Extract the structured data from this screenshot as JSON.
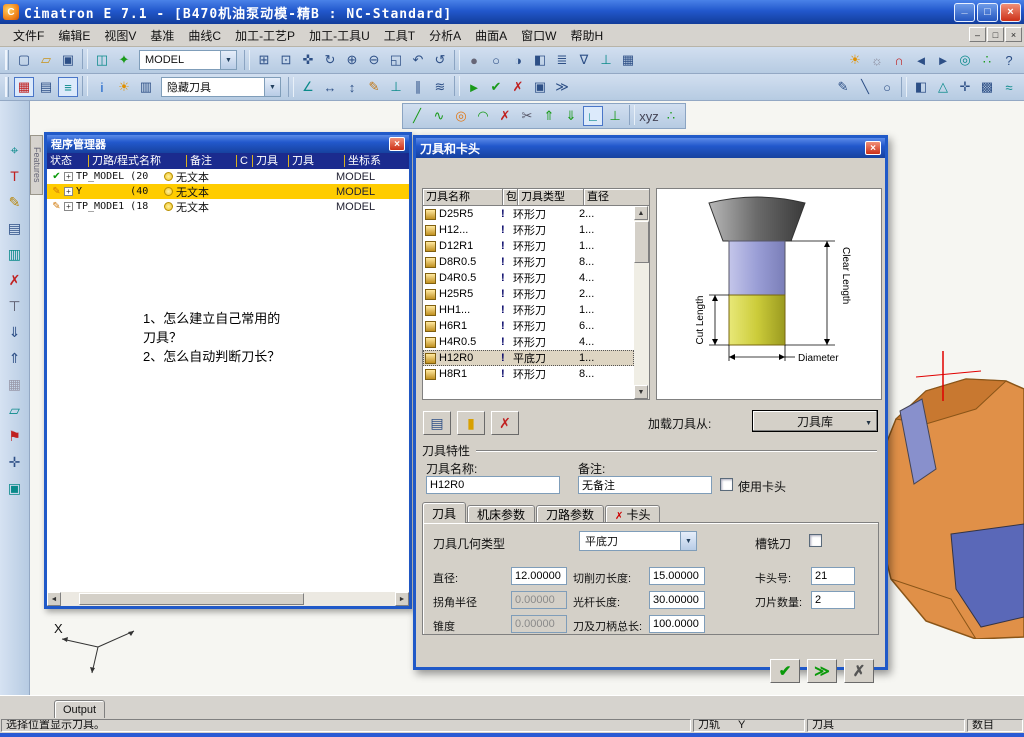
{
  "window": {
    "title": "Cimatron E 7.1 - [B470机油泵动模-精B : NC-Standard]"
  },
  "menu": {
    "items": [
      {
        "label": "文件F"
      },
      {
        "label": "编辑E"
      },
      {
        "label": "视图V"
      },
      {
        "label": "基准"
      },
      {
        "label": "曲线C"
      },
      {
        "label": "加工-工艺P"
      },
      {
        "label": "加工-工具U"
      },
      {
        "label": "工具T"
      },
      {
        "label": "分析A"
      },
      {
        "label": "曲面A"
      },
      {
        "label": "窗口W"
      },
      {
        "label": "帮助H"
      }
    ]
  },
  "combos": {
    "model": "MODEL",
    "hide": "隐藏刀具"
  },
  "features_tab": "Features",
  "toolbars": {
    "tb1a": [
      {
        "n": "new-file-icon",
        "g": "▢",
        "c": "#2d4f86"
      },
      {
        "n": "open-file-icon",
        "g": "▱",
        "c": "#c8931a"
      },
      {
        "n": "save-icon",
        "g": "▣",
        "c": "#2d4f86"
      },
      "|",
      {
        "n": "load-model-icon",
        "g": "◫",
        "c": "#0a8a8a"
      },
      {
        "n": "refresh-model-icon",
        "g": "✦",
        "c": "#1a9a1a"
      }
    ],
    "tb1b": [
      {
        "n": "select-filter-icon",
        "g": "⊞",
        "c": "#2d4f86"
      },
      {
        "n": "zoom-window-icon",
        "g": "⊡",
        "c": "#2d4f86"
      },
      {
        "n": "pan-icon",
        "g": "✜",
        "c": "#2d4f86"
      },
      {
        "n": "rotate-view-icon",
        "g": "↻",
        "c": "#2d4f86"
      },
      {
        "n": "zoom-in-icon",
        "g": "⊕",
        "c": "#2d4f86"
      },
      {
        "n": "zoom-out-icon",
        "g": "⊖",
        "c": "#2d4f86"
      },
      {
        "n": "zoom-fit-icon",
        "g": "◱",
        "c": "#2d4f86"
      },
      {
        "n": "previous-view-icon",
        "g": "↶",
        "c": "#2d4f86"
      },
      {
        "n": "redraw-icon",
        "g": "↺",
        "c": "#2d4f86"
      }
    ],
    "tb1c": [
      {
        "n": "shaded-display-icon",
        "g": "●",
        "c": "#667"
      },
      {
        "n": "wireframe-display-icon",
        "g": "○",
        "c": "#2d4f86"
      },
      {
        "n": "hidden-line-icon",
        "g": "◑",
        "c": "#2d4f86"
      },
      {
        "n": "section-icon",
        "g": "◧",
        "c": "#2d4f86"
      },
      {
        "n": "layers-icon",
        "g": "≣",
        "c": "#2d4f86"
      },
      {
        "n": "display-filter-icon",
        "g": "∇",
        "c": "#2d4f86"
      },
      {
        "n": "ucs-icon",
        "g": "⊥",
        "c": "#0a8a8a"
      },
      {
        "n": "grid-icon",
        "g": "▦",
        "c": "#2d4f86"
      }
    ],
    "tb1r": [
      {
        "n": "light-on-icon",
        "g": "☀",
        "c": "#e09000"
      },
      {
        "n": "light-off-icon",
        "g": "☼",
        "c": "#889"
      },
      {
        "n": "magnet-icon",
        "g": "∩",
        "c": "#c02020"
      },
      {
        "n": "step-back-icon",
        "g": "◄",
        "c": "#2d4f86"
      },
      {
        "n": "step-forward-icon",
        "g": "►",
        "c": "#2d4f86"
      },
      {
        "n": "target-icon",
        "g": "◎",
        "c": "#0a8a8a"
      },
      {
        "n": "snap-points-icon",
        "g": "∴",
        "c": "#1a9a1a"
      },
      {
        "n": "help-icon",
        "g": "?",
        "c": "#2d4f86"
      }
    ],
    "tb2a": [
      {
        "n": "program-manager-icon",
        "g": "▦",
        "c": "#c02020",
        "a": 1
      },
      {
        "n": "process-table-icon",
        "g": "▤",
        "c": "#2d4f86"
      },
      {
        "n": "tool-manager-icon",
        "g": "≡",
        "c": "#0a8a8a",
        "a": 1
      },
      "|",
      {
        "n": "info-icon",
        "g": "i",
        "c": "#0a58c8"
      },
      {
        "n": "show-hide-icon",
        "g": "☀",
        "c": "#e09000"
      },
      {
        "n": "report-icon",
        "g": "▥",
        "c": "#2d4f86"
      }
    ],
    "tb2b": [
      {
        "n": "measure-angle-icon",
        "g": "∠",
        "c": "#0a8a8a"
      },
      {
        "n": "measure-distance-icon",
        "g": "↔",
        "c": "#2d4f86"
      },
      {
        "n": "measure-height-icon",
        "g": "↕",
        "c": "#2d4f86"
      },
      {
        "n": "annotate-icon",
        "g": "✎",
        "c": "#c07818"
      },
      {
        "n": "normal-check-icon",
        "g": "⊥",
        "c": "#0a8a8a"
      },
      {
        "n": "parallel-icon",
        "g": "∥",
        "c": "#2d4f86"
      },
      {
        "n": "surface-analysis-icon",
        "g": "≋",
        "c": "#2d4f86"
      },
      "|",
      {
        "n": "simulate-icon",
        "g": "►",
        "c": "#1a9a1a"
      },
      {
        "n": "verify-icon",
        "g": "✔",
        "c": "#1a9a1a"
      },
      {
        "n": "stop-icon",
        "g": "✗",
        "c": "#c02020"
      },
      {
        "n": "nc-output-icon",
        "g": "▣",
        "c": "#2d4f86"
      },
      {
        "n": "post-process-icon",
        "g": "≫",
        "c": "#2d4f86"
      }
    ],
    "tb2r": [
      {
        "n": "sketch-icon",
        "g": "✎",
        "c": "#2d4f86"
      },
      {
        "n": "line-tool-icon",
        "g": "╲",
        "c": "#2d4f86"
      },
      {
        "n": "circle-tool-icon",
        "g": "○",
        "c": "#2d4f86"
      },
      "|",
      {
        "n": "solid-icon",
        "g": "◧",
        "c": "#2d4f86"
      },
      {
        "n": "mesh-icon",
        "g": "△",
        "c": "#0a8a8a"
      },
      {
        "n": "axes-icon",
        "g": "✛",
        "c": "#2d4f86"
      },
      {
        "n": "hatch-icon",
        "g": "▩",
        "c": "#2d4f86"
      },
      {
        "n": "smooth-icon",
        "g": "≈",
        "c": "#0a8a8a"
      }
    ],
    "tb3": [
      {
        "n": "line-icon",
        "g": "╱",
        "c": "#1a9a1a"
      },
      {
        "n": "spline-icon",
        "g": "∿",
        "c": "#1a9a1a"
      },
      {
        "n": "circle-icon",
        "g": "◎",
        "c": "#e07818"
      },
      {
        "n": "arc-icon",
        "g": "◠",
        "c": "#1a9a1a"
      },
      {
        "n": "delete-icon",
        "g": "✗",
        "c": "#c02020"
      },
      {
        "n": "trim-icon",
        "g": "✂",
        "c": "#556"
      },
      {
        "n": "extend-up-icon",
        "g": "⇑",
        "c": "#1a9a1a"
      },
      {
        "n": "extend-down-icon",
        "g": "⇓",
        "c": "#1a9a1a"
      },
      {
        "n": "corner-icon",
        "g": "∟",
        "c": "#0a8a8a",
        "a": 1
      },
      {
        "n": "perpendicular-icon",
        "g": "⊥",
        "c": "#1a9a1a"
      },
      "|",
      {
        "n": "xyz-coords-icon",
        "g": "xyz",
        "c": "#445"
      },
      {
        "n": "snap-point-icon",
        "g": "∴",
        "c": "#1a9a1a"
      }
    ],
    "left": [
      {
        "n": "select-target-icon",
        "g": "⌖",
        "c": "#0a8a8a"
      },
      {
        "n": "text-tool-icon",
        "g": "T",
        "c": "#c02020"
      },
      {
        "n": "edit-sketch-icon",
        "g": "✎",
        "c": "#b8860b"
      },
      {
        "n": "document-icon",
        "g": "▤",
        "c": "#2d4f86"
      },
      {
        "n": "catalog-icon",
        "g": "▥",
        "c": "#0a8a8a"
      },
      {
        "n": "delete-entity-icon",
        "g": "✗",
        "c": "#c02020"
      },
      {
        "n": "tool-icon",
        "g": "⊤",
        "c": "#556"
      },
      {
        "n": "import-icon",
        "g": "⇓",
        "c": "#2d4f86"
      },
      {
        "n": "export-icon",
        "g": "⇑",
        "c": "#2d4f86"
      },
      {
        "n": "grid-icon",
        "g": "▦",
        "c": "#99a"
      },
      {
        "n": "plane-icon",
        "g": "▱",
        "c": "#0a8a8a"
      },
      {
        "n": "flag-icon",
        "g": "⚑",
        "c": "#c02020"
      },
      {
        "n": "axes-icon",
        "g": "✛",
        "c": "#2d4f86"
      },
      {
        "n": "table-icon",
        "g": "▣",
        "c": "#0a8a8a"
      }
    ],
    "dlg_tools": [
      {
        "n": "edit-tool-table-button",
        "g": "▤",
        "c": "#2d4f86"
      },
      {
        "n": "holder-library-button",
        "g": "▮",
        "c": "#d8a000"
      },
      {
        "n": "delete-tool-button",
        "g": "✗",
        "c": "#c02020"
      }
    ],
    "dlg_confirm": [
      {
        "n": "ok-button",
        "g": "✔",
        "c": "#0a9a0a"
      },
      {
        "n": "apply-next-button",
        "g": "≫",
        "c": "#0a9a0a"
      },
      {
        "n": "cancel-button",
        "g": "✗",
        "c": "#555"
      }
    ]
  },
  "program_manager": {
    "title": "程序管理器",
    "columns": [
      {
        "label": "状态"
      },
      {
        "label": "刀路/程式名称"
      },
      {
        "label": "备注"
      },
      {
        "label": "C"
      },
      {
        "label": "刀具"
      },
      {
        "label": "刀具"
      },
      {
        "label": "坐标系"
      }
    ],
    "rows": [
      {
        "status": "✔",
        "cls": "ok",
        "name": "TP_MODEL (20",
        "note": "无文本",
        "cs": "MODEL"
      },
      {
        "status": "✎",
        "cls": "ed",
        "sel": 1,
        "name": "Y        (40",
        "note": "无文本",
        "cs": "MODEL"
      },
      {
        "status": "✎",
        "cls": "ed",
        "name": "TP_MODE1 (18",
        "note": "无文本",
        "cs": "MODEL"
      }
    ],
    "annotation": [
      "1、怎么建立自己常用的",
      "刀具？",
      "2、怎么自动判断刀长？"
    ]
  },
  "tool_dialog": {
    "title": "刀具和卡头",
    "table": {
      "columns": [
        {
          "label": "刀具名称"
        },
        {
          "label": "包"
        },
        {
          "label": "刀具类型"
        },
        {
          "label": "直径"
        }
      ],
      "rows": [
        {
          "name": "D25R5",
          "flag": "!",
          "type": "环形刀",
          "dia": "2..."
        },
        {
          "name": "H12...",
          "flag": "!",
          "type": "环形刀",
          "dia": "1..."
        },
        {
          "name": "D12R1",
          "flag": "!",
          "type": "环形刀",
          "dia": "1..."
        },
        {
          "name": "D8R0.5",
          "flag": "!",
          "type": "环形刀",
          "dia": "8..."
        },
        {
          "name": "D4R0.5",
          "flag": "!",
          "type": "环形刀",
          "dia": "4..."
        },
        {
          "name": "H25R5",
          "flag": "!",
          "type": "环形刀",
          "dia": "2..."
        },
        {
          "name": "HH1...",
          "flag": "!",
          "type": "环形刀",
          "dia": "1..."
        },
        {
          "name": "H6R1",
          "flag": "!",
          "type": "环形刀",
          "dia": "6..."
        },
        {
          "name": "H4R0.5",
          "flag": "!",
          "type": "环形刀",
          "dia": "4..."
        },
        {
          "name": "H12R0",
          "flag": "!",
          "type": "平底刀",
          "dia": "1...",
          "sel": 1
        },
        {
          "name": "H8R1",
          "flag": "!",
          "type": "环形刀",
          "dia": "8..."
        }
      ]
    },
    "preview": {
      "cut_label": "Cut Length",
      "clear_label": "Clear Length",
      "diameter_label": "Diameter"
    },
    "load_from_label": "加载刀具从:",
    "library_button": "刀具库",
    "section_title": "刀具特性",
    "name_label": "刀具名称:",
    "name_value": "H12R0",
    "note_label": "备注:",
    "note_value": "无备注",
    "use_holder_label": "使用卡头",
    "tabs": [
      {
        "label": "刀具"
      },
      {
        "label": "机床参数"
      },
      {
        "label": "刀路参数"
      },
      {
        "label": "卡头"
      }
    ],
    "geometry_label": "刀具几何类型",
    "geometry_value": "平底刀",
    "slot_mill_label": "槽铣刀",
    "params": {
      "diameter": {
        "label": "直径:",
        "value": "12.00000"
      },
      "cut_edge": {
        "label": "切削刃长度:",
        "value": "15.00000"
      },
      "holder_number": {
        "label": "卡头号:",
        "value": "21"
      },
      "corner_radius": {
        "label": "拐角半径",
        "value": "0.00000"
      },
      "shank_length": {
        "label": "光杆长度:",
        "value": "30.00000"
      },
      "insert_count": {
        "label": "刀片数量:",
        "value": "2"
      },
      "taper": {
        "label": "锥度",
        "value": "0.00000"
      },
      "total_length": {
        "label": "刀及刀柄总长:",
        "value": "100.0000"
      }
    }
  },
  "viewport": {
    "axis_x": "X"
  },
  "output_tab": "Output",
  "status_bar": {
    "message": "选择位置显示刀具。",
    "panels": [
      {
        "label": "刀轨",
        "value": "Y"
      },
      {
        "label": "刀具",
        "value": ""
      },
      {
        "label": "数目",
        "value": ""
      }
    ]
  }
}
